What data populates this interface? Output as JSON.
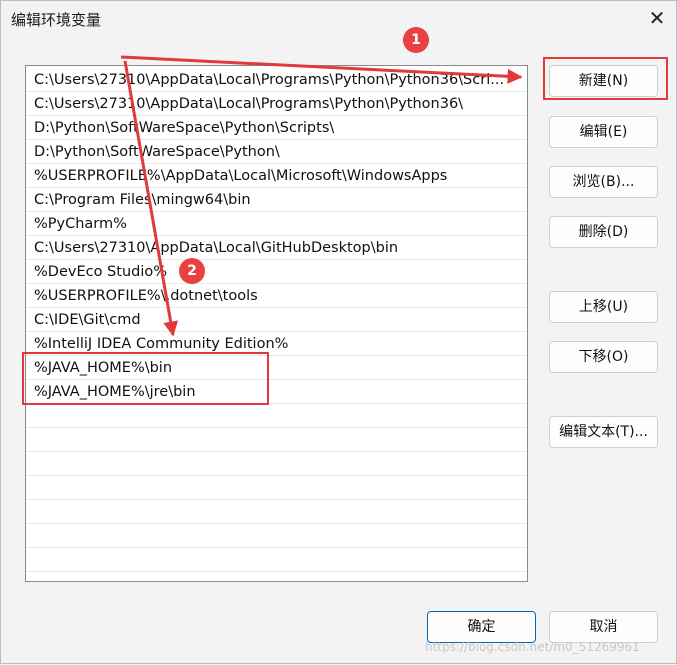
{
  "window": {
    "title": "编辑环境变量"
  },
  "paths": [
    "C:\\Users\\27310\\AppData\\Local\\Programs\\Python\\Python36\\Scri...",
    "C:\\Users\\27310\\AppData\\Local\\Programs\\Python\\Python36\\",
    "D:\\Python\\SoftWareSpace\\Python\\Scripts\\",
    "D:\\Python\\SoftWareSpace\\Python\\",
    "%USERPROFILE%\\AppData\\Local\\Microsoft\\WindowsApps",
    "C:\\Program Files\\mingw64\\bin",
    "%PyCharm%",
    "C:\\Users\\27310\\AppData\\Local\\GitHubDesktop\\bin",
    "%DevEco Studio%",
    "%USERPROFILE%\\.dotnet\\tools",
    "C:\\IDE\\Git\\cmd",
    "%IntelliJ IDEA Community Edition%",
    "%JAVA_HOME%\\bin",
    "%JAVA_HOME%\\jre\\bin"
  ],
  "buttons": {
    "new": "新建(N)",
    "edit": "编辑(E)",
    "browse": "浏览(B)...",
    "delete": "删除(D)",
    "move_up": "上移(U)",
    "move_down": "下移(O)",
    "edit_text": "编辑文本(T)...",
    "ok": "确定",
    "cancel": "取消"
  },
  "annotations": {
    "badge_1": "1",
    "badge_2": "2"
  },
  "watermark": "https://blog.csdn.net/m0_51269961",
  "colors": {
    "annotation": "#e03a3a",
    "primary_border": "#0067c0"
  }
}
